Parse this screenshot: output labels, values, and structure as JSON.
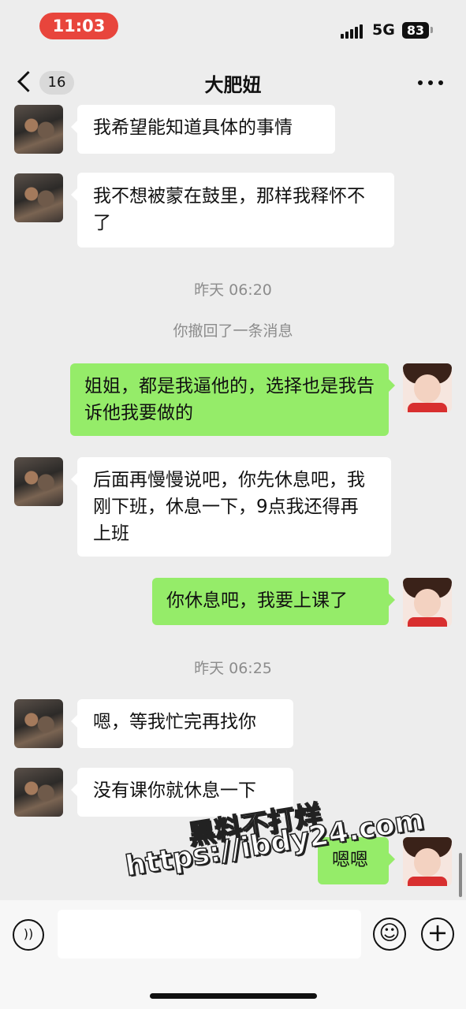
{
  "status_bar": {
    "time": "11:03",
    "network": "5G",
    "battery": "83"
  },
  "nav": {
    "unread_count": "16",
    "title": "大肥妞"
  },
  "messages": [
    {
      "sender": "other",
      "text": "我希望能知道具体的事情"
    },
    {
      "sender": "other",
      "text": "我不想被蒙在鼓里，那样我释怀不了"
    },
    {
      "sender": "self",
      "text": "姐姐，都是我逼他的，选择也是我告诉他我要做的"
    },
    {
      "sender": "other",
      "text": "后面再慢慢说吧，你先休息吧，我刚下班，休息一下，9点我还得再上班"
    },
    {
      "sender": "self",
      "text": "你休息吧，我要上课了"
    },
    {
      "sender": "other",
      "text": "嗯，等我忙完再找你"
    },
    {
      "sender": "other",
      "text": "没有课你就休息一下"
    },
    {
      "sender": "self",
      "text": "嗯嗯"
    }
  ],
  "timestamps": [
    "昨天 06:20",
    "昨天 06:25"
  ],
  "recall_notice": "你撤回了一条消息",
  "watermark": {
    "line1": "黑料不打烊",
    "line2": "https://ibdy24.com"
  },
  "colors": {
    "incoming_bubble": "#ffffff",
    "outgoing_bubble": "#95ec69",
    "background": "#ededed",
    "time_pill": "#e8453c"
  }
}
